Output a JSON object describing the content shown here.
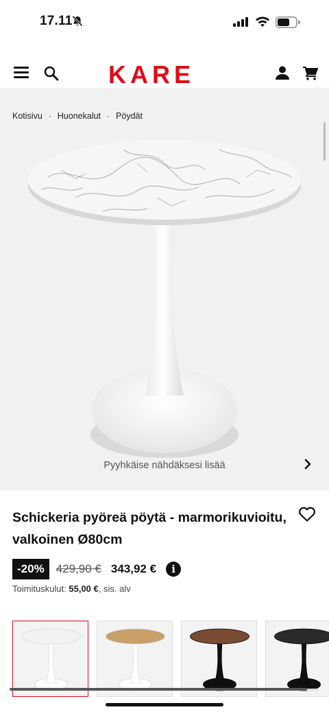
{
  "status_bar": {
    "time": "17.11"
  },
  "header": {
    "logo": "KARE"
  },
  "breadcrumb": [
    {
      "label": "Kotisivu"
    },
    {
      "label": "Huonekalut"
    },
    {
      "label": "Pöydät"
    }
  ],
  "breadcrumb_separator": "·",
  "gallery": {
    "swipe_hint": "Pyyhkäise nähdäksesi lisää"
  },
  "product": {
    "title": "Schickeria pyöreä pöytä - marmorikuvioitu, valkoinen Ø80cm",
    "discount": "-20%",
    "old_price": "429,90 €",
    "price": "343,92 €",
    "info_symbol": "i",
    "shipping_prefix": "Toimituskulut:",
    "shipping_amount": "55,00 €",
    "shipping_suffix": ", sis. alv"
  },
  "variants": [
    {
      "name": "white-marble",
      "top_color": "#f2f2f2",
      "base_color": "#ffffff",
      "selected": true
    },
    {
      "name": "oak",
      "top_color": "#c9a069",
      "base_color": "#ffffff",
      "selected": false
    },
    {
      "name": "walnut",
      "top_color": "#7a4b33",
      "base_color": "#111111",
      "selected": false
    },
    {
      "name": "black-marble",
      "top_color": "#2a2a2a",
      "base_color": "#111111",
      "selected": false
    }
  ],
  "colors": {
    "brand": "#e10a17",
    "gallery_bg": "#f1f1f1"
  }
}
